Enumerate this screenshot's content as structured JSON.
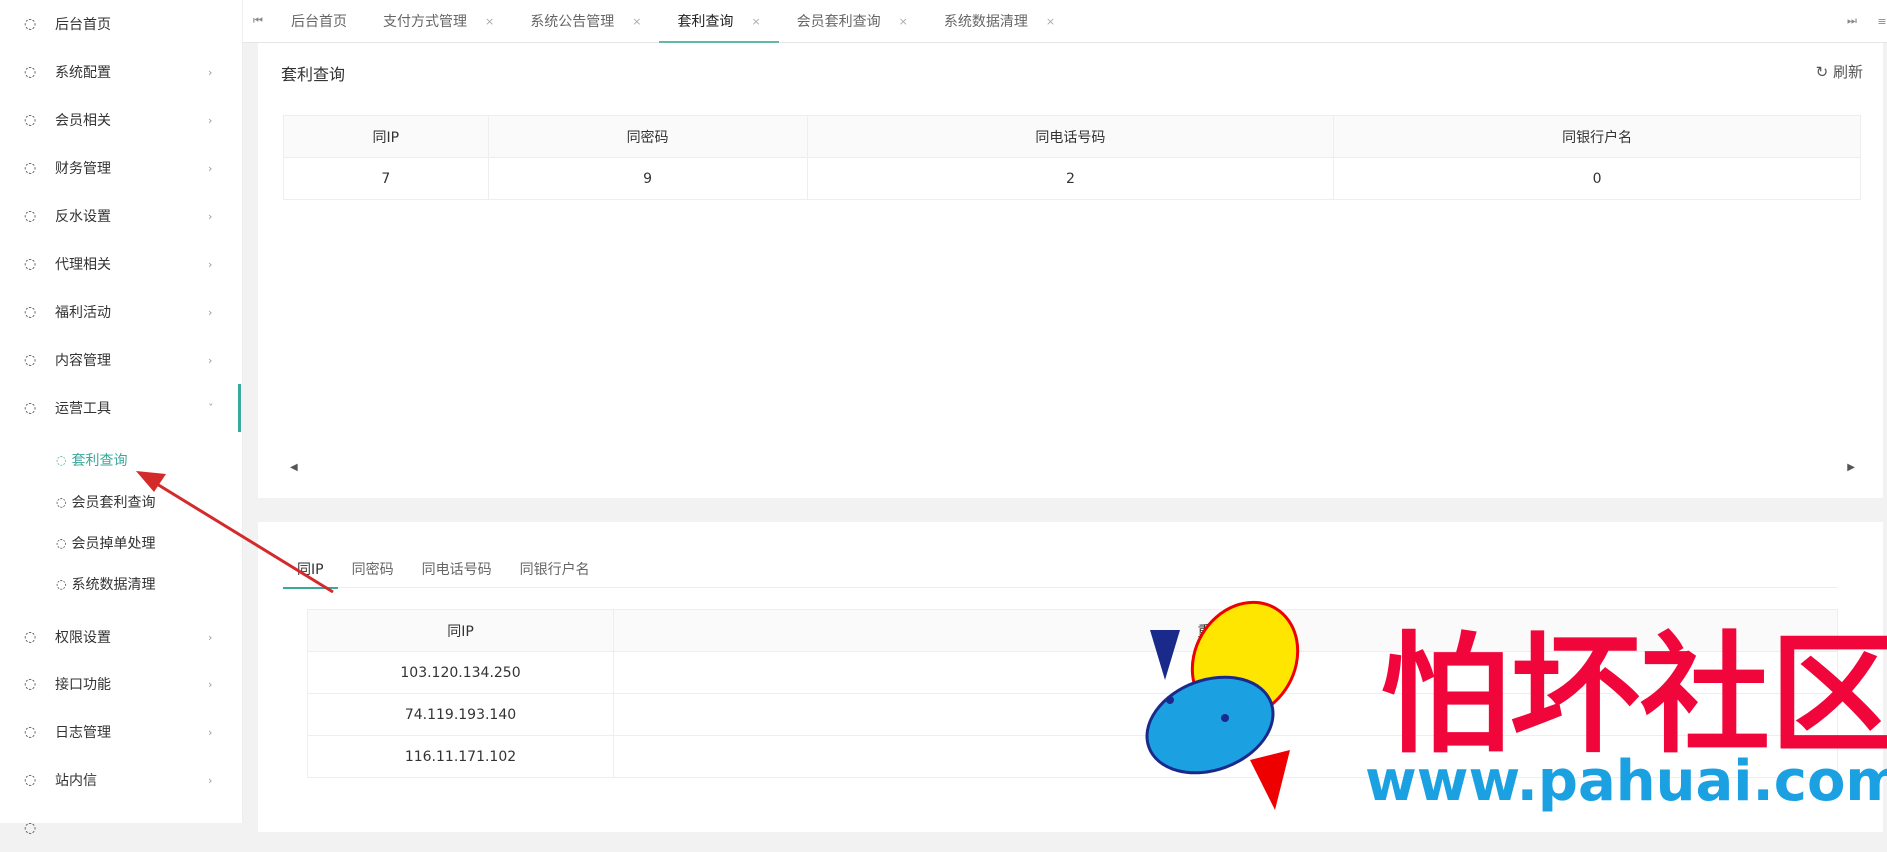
{
  "sidebar": {
    "items": [
      {
        "label": "后台首页",
        "chevron": false
      },
      {
        "label": "系统配置",
        "chevron": true
      },
      {
        "label": "会员相关",
        "chevron": true
      },
      {
        "label": "财务管理",
        "chevron": true
      },
      {
        "label": "反水设置",
        "chevron": true
      },
      {
        "label": "代理相关",
        "chevron": true
      },
      {
        "label": "福利活动",
        "chevron": true
      },
      {
        "label": "内容管理",
        "chevron": true
      },
      {
        "label": "运营工具",
        "chevron": true,
        "open": true
      }
    ],
    "sub_items": [
      {
        "label": "套利查询",
        "active": true
      },
      {
        "label": "会员套利查询"
      },
      {
        "label": "会员掉单处理"
      },
      {
        "label": "系统数据清理"
      }
    ],
    "items_after": [
      {
        "label": "权限设置"
      },
      {
        "label": "接口功能"
      },
      {
        "label": "日志管理"
      },
      {
        "label": "站内信"
      }
    ]
  },
  "tabs": [
    {
      "label": "后台首页"
    },
    {
      "label": "支付方式管理",
      "close": "×"
    },
    {
      "label": "系统公告管理",
      "close": "×"
    },
    {
      "label": "套利查询",
      "close": "×",
      "active": true
    },
    {
      "label": "会员套利查询",
      "close": "×"
    },
    {
      "label": "系统数据清理",
      "close": "×"
    }
  ],
  "panel": {
    "title": "套利查询",
    "refresh_label": "刷新",
    "summary": {
      "headers": [
        "同IP",
        "同密码",
        "同电话号码",
        "同银行户名"
      ],
      "values": [
        "7",
        "9",
        "2",
        "0"
      ]
    }
  },
  "detail": {
    "tabs": [
      "同IP",
      "同密码",
      "同电话号码",
      "同银行户名"
    ],
    "headers": [
      "同IP",
      "重复账号"
    ],
    "rows": [
      [
        "103.120.134.250",
        ""
      ],
      [
        "74.119.193.140",
        ""
      ],
      [
        "116.11.171.102",
        ""
      ]
    ]
  },
  "watermark": {
    "name": "怕坏社区",
    "url": "www.pahuai.com"
  },
  "colors": {
    "accent": "#3aa89a",
    "arrow": "#d42a2a",
    "watermark_red": "#f0063a",
    "watermark_blue": "#1ba1e2"
  }
}
